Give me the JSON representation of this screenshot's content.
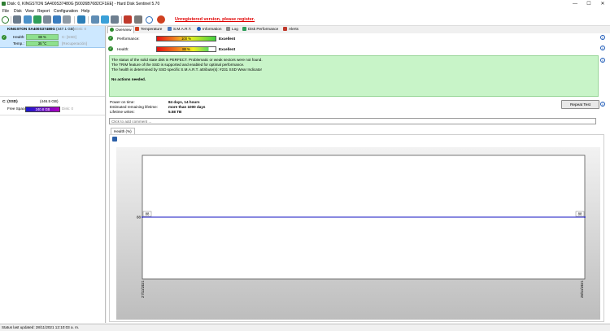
{
  "window": {
    "title": "Disk: 0, KINGSTON SA400S37480G [50026B7682CF1EE] - Hard Disk Sentinel 5.70",
    "minimize_glyph": "—",
    "maximize_glyph": "☐",
    "close_glyph": "✕"
  },
  "menu": {
    "items": [
      "File",
      "Disk",
      "View",
      "Report",
      "Configuration",
      "Help"
    ]
  },
  "toolbar": {
    "unregistered_text": "Unregistered version, please register."
  },
  "left": {
    "disk": {
      "name": "KINGSTON SA400S37480G",
      "size": "(447.1 GB)",
      "disk_index": "Disk: 0",
      "health_label": "Health:",
      "health_value": "88 %",
      "health_drive": "C: [SSD]",
      "temp_label": "Temp.:",
      "temp_value": "35 °C",
      "temp_note": "[Recuperación]"
    },
    "volume": {
      "name": "C: (SSD)",
      "size": "(446.5 GB)",
      "free_label": "Free Space",
      "free_value": "240.8 GB",
      "disk_ref": "Disk: 0"
    }
  },
  "tabs": [
    "Overview",
    "Temperature",
    "S.M.A.R.T.",
    "Information",
    "Log",
    "Disk Performance",
    "Alerts"
  ],
  "overview": {
    "performance_label": "Performance:",
    "performance_value": "100 %",
    "performance_level": 1.0,
    "performance_rating": "Excellent",
    "health_label": "Health:",
    "health_value": "88 %",
    "health_level": 0.88,
    "health_rating": "Excellent",
    "status_lines": [
      "The status of the solid state disk is PERFECT. Problematic or weak sectors were not found.",
      "The TRIM feature of the SSD is supported and enabled for optimal performance.",
      "The health is determined by SSD specific S.M.A.R.T. attribute(s):  #231 SSD Wear Indicator"
    ],
    "no_actions": "No actions needed.",
    "power_on_label": "Power on time:",
    "power_on_value": "84 days, 14 hours",
    "lifetime_label": "Estimated remaining lifetime:",
    "lifetime_value": "more than 1000 days",
    "writes_label": "Lifetime writes:",
    "writes_value": "5.58 TB",
    "repeat_test_label": "Repeat Test",
    "comment_placeholder": "Click to add comment ..."
  },
  "graph": {
    "tab_label": "Health (%)",
    "save_icon": "floppy-disk-icon"
  },
  "chart_data": {
    "type": "line",
    "x": [
      "27/11/2021",
      "28/11/2021"
    ],
    "series": [
      {
        "values": [
          88,
          88
        ]
      }
    ],
    "point_labels": [
      "88",
      "88"
    ],
    "y_tick_label": "88",
    "line_color": "#1010c0"
  },
  "statusbar": {
    "text": "Status last updated: 28/11/2021 12:10:03 a. m."
  }
}
